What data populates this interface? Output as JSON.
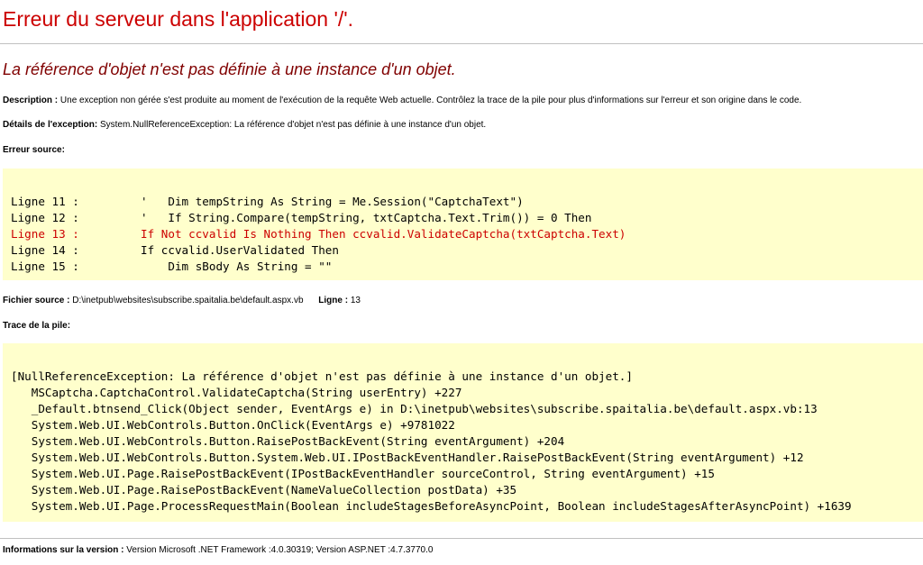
{
  "page": {
    "title": "Erreur du serveur dans l'application '/'.",
    "subtitle": "La référence d'objet n'est pas définie à une instance d'un objet."
  },
  "description": {
    "label": "Description :",
    "text": "Une exception non gérée s'est produite au moment de l'exécution de la requête Web actuelle. Contrôlez la trace de la pile pour plus d'informations sur l'erreur et son origine dans le code."
  },
  "exception": {
    "label": "Détails de l'exception:",
    "text": "System.NullReferenceException: La référence d'objet n'est pas définie à une instance d'un objet."
  },
  "source_error": {
    "label": "Erreur source:",
    "lines": [
      "Ligne 11 :         '   Dim tempString As String = Me.Session(\"CaptchaText\")",
      "Ligne 12 :         '   If String.Compare(tempString, txtCaptcha.Text.Trim()) = 0 Then",
      "Ligne 13 :         If Not ccvalid Is Nothing Then ccvalid.ValidateCaptcha(txtCaptcha.Text)",
      "Ligne 14 :         If ccvalid.UserValidated Then",
      "Ligne 15 :             Dim sBody As String = \"\""
    ],
    "error_color": "#cc0000"
  },
  "source_file": {
    "label": "Fichier source :",
    "path": "D:\\inetpub\\websites\\subscribe.spaitalia.be\\default.aspx.vb",
    "line_label": "Ligne :",
    "line_number": "13"
  },
  "stack_trace": {
    "label": "Trace de la pile:",
    "lines": [
      "[NullReferenceException: La référence d'objet n'est pas définie à une instance d'un objet.]",
      "   MSCaptcha.CaptchaControl.ValidateCaptcha(String userEntry) +227",
      "   _Default.btnsend_Click(Object sender, EventArgs e) in D:\\inetpub\\websites\\subscribe.spaitalia.be\\default.aspx.vb:13",
      "   System.Web.UI.WebControls.Button.OnClick(EventArgs e) +9781022",
      "   System.Web.UI.WebControls.Button.RaisePostBackEvent(String eventArgument) +204",
      "   System.Web.UI.WebControls.Button.System.Web.UI.IPostBackEventHandler.RaisePostBackEvent(String eventArgument) +12",
      "   System.Web.UI.Page.RaisePostBackEvent(IPostBackEventHandler sourceControl, String eventArgument) +15",
      "   System.Web.UI.Page.RaisePostBackEvent(NameValueCollection postData) +35",
      "   System.Web.UI.Page.ProcessRequestMain(Boolean includeStagesBeforeAsyncPoint, Boolean includeStagesAfterAsyncPoint) +1639"
    ]
  },
  "version": {
    "label": "Informations sur la version :",
    "text": "Version Microsoft .NET Framework :4.0.30319; Version ASP.NET :4.7.3770.0"
  },
  "colors": {
    "title": "#cc0000",
    "subtitle": "#800000",
    "code_background": "#ffffcc",
    "rule": "#c0c0c0"
  }
}
